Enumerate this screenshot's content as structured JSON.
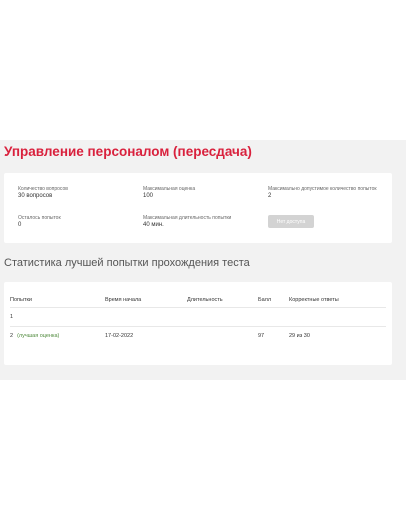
{
  "course": {
    "title": "Управление персоналом (пересдача)"
  },
  "info": {
    "questions_label": "Количество вопросов",
    "questions_value": "30 вопросов",
    "max_score_label": "Максимальная оценка",
    "max_score_value": "100",
    "max_attempts_label": "Максимально допустимое количество попыток",
    "max_attempts_value": "2",
    "remaining_label": "Осталось попыток",
    "remaining_value": "0",
    "max_duration_label": "Максимальная длительность попытки",
    "max_duration_value": "40 мин.",
    "unavailable_button": "Нет доступа"
  },
  "stats": {
    "title": "Статистика лучшей попытки прохождения теста",
    "columns": [
      "Попытки",
      "Время начала",
      "Длительность",
      "Балл",
      "Корректные ответы"
    ],
    "rows": [
      {
        "attempt": "1",
        "tag": "",
        "start": "",
        "duration": "",
        "score": "",
        "correct": ""
      },
      {
        "attempt": "2",
        "tag": "(лучшая оценка)",
        "start": "17-02-2022",
        "duration": "",
        "score": "97",
        "correct": "29 из 30"
      }
    ]
  },
  "colors": {
    "accent": "#d9213d",
    "best_tag": "#4f8a3c",
    "panel_bg": "#f2f2f2",
    "button_disabled": "#d3d3d3"
  }
}
